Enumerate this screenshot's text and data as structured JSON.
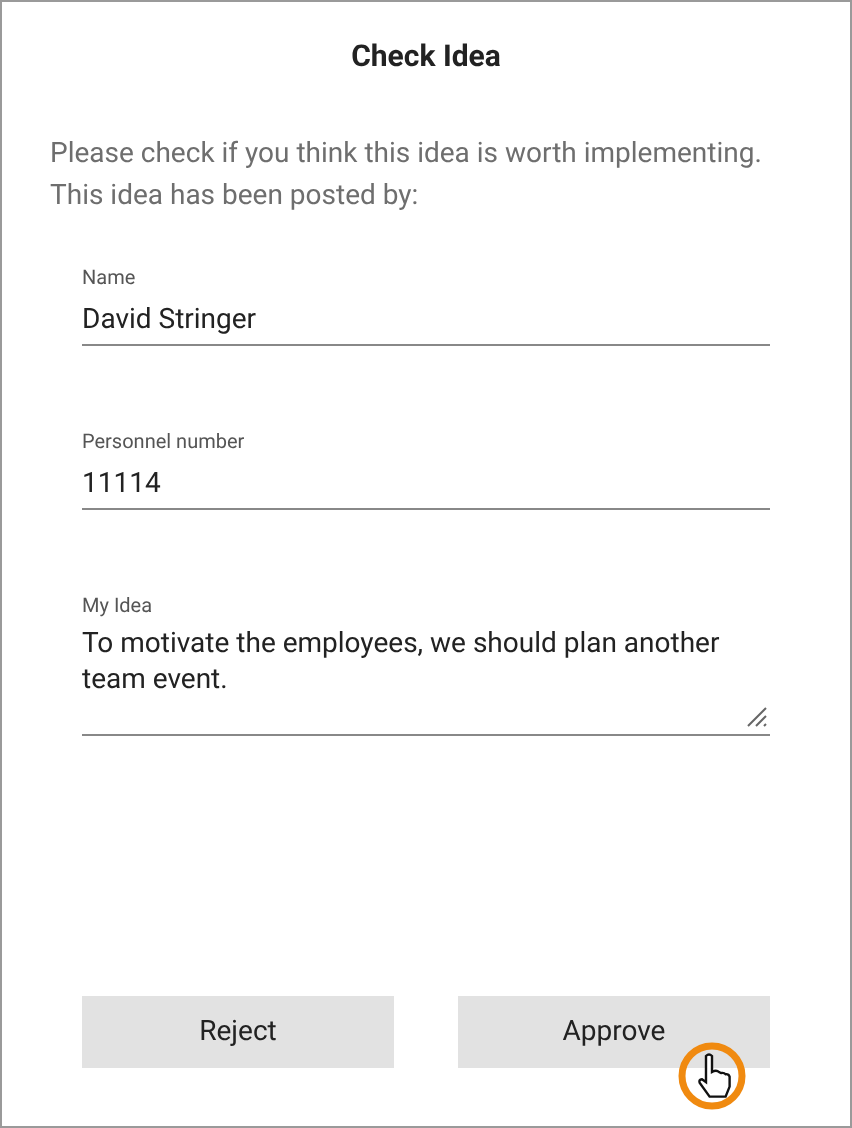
{
  "dialog": {
    "title": "Check Idea",
    "intro": "Please check if you think this idea is worth implementing. This idea has been posted by:",
    "fields": [
      {
        "kind": "input",
        "label": "Name",
        "value": "David Stringer"
      },
      {
        "kind": "input",
        "label": "Personnel number",
        "value": "11114"
      },
      {
        "kind": "textarea",
        "label": "My Idea",
        "value": "To motivate the employees, we should plan another team event."
      }
    ],
    "buttons": [
      "Reject",
      "Approve"
    ]
  }
}
